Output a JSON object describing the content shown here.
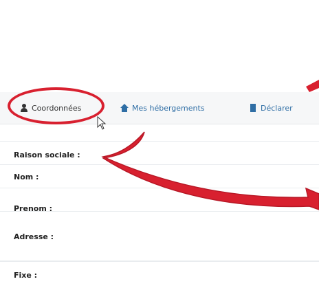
{
  "tabs": {
    "coordonnees": {
      "label": "Coordonnées",
      "icon": "user-icon"
    },
    "hebergements": {
      "label": "Mes hébergements",
      "icon": "home-icon"
    },
    "declarer": {
      "label": "Déclarer",
      "icon": "file-icon"
    }
  },
  "form": {
    "raison_sociale": "Raison sociale :",
    "nom": "Nom :",
    "prenom": "Prenom :",
    "adresse": "Adresse :",
    "fixe": "Fixe :"
  },
  "colors": {
    "annotation_red": "#d8202f",
    "link_blue": "#2f6ea5",
    "tab_bar_bg": "#f6f7f8"
  }
}
